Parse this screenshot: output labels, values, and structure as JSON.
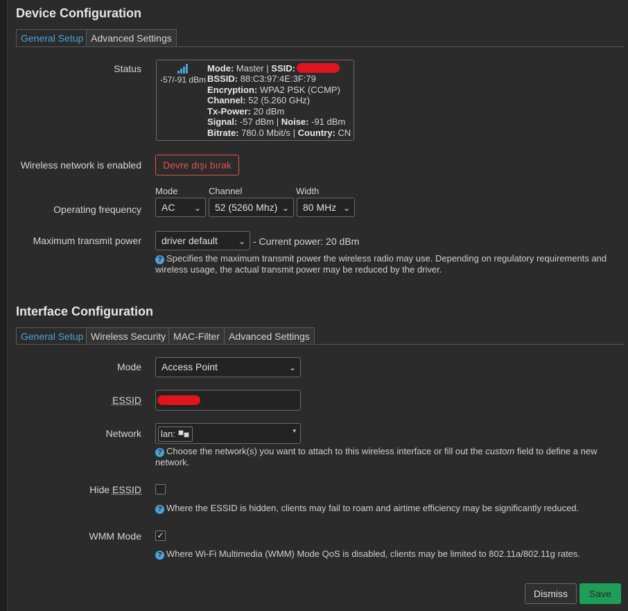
{
  "device": {
    "title": "Device Configuration",
    "tabs": [
      "General Setup",
      "Advanced Settings"
    ],
    "status": {
      "label": "Status",
      "signal_icon": "signal-bars-icon",
      "signal_text": "-57/-91 dBm",
      "mode_label": "Mode:",
      "mode_value": "Master",
      "sep": "|",
      "ssid_label": "SSID:",
      "bssid_label": "BSSID:",
      "bssid_value": "88:C3:97:4E:3F:79",
      "enc_label": "Encryption:",
      "enc_value": "WPA2 PSK (CCMP)",
      "channel_label": "Channel:",
      "channel_value": "52 (5.260 GHz)",
      "txpower_label": "Tx-Power:",
      "txpower_value": "20 dBm",
      "signal_label": "Signal:",
      "signal_value": "-57 dBm",
      "noise_label": "Noise:",
      "noise_value": "-91 dBm",
      "bitrate_label": "Bitrate:",
      "bitrate_value": "780.0 Mbit/s",
      "country_label": "Country:",
      "country_value": "CN"
    },
    "enabled": {
      "label": "Wireless network is enabled",
      "button": "Devre dışı bırak"
    },
    "frequency": {
      "label": "Operating frequency",
      "mode_header": "Mode",
      "channel_header": "Channel",
      "width_header": "Width",
      "mode_value": "AC",
      "channel_value": "52 (5260 Mhz)",
      "width_value": "80 MHz"
    },
    "txpower": {
      "label": "Maximum transmit power",
      "value": "driver default",
      "current": "- Current power: 20 dBm",
      "help": "Specifies the maximum transmit power the wireless radio may use. Depending on regulatory requirements and wireless usage, the actual transmit power may be reduced by the driver."
    }
  },
  "interface": {
    "title": "Interface Configuration",
    "tabs": [
      "General Setup",
      "Wireless Security",
      "MAC-Filter",
      "Advanced Settings"
    ],
    "mode": {
      "label": "Mode",
      "value": "Access Point"
    },
    "essid": {
      "label": "ESSID"
    },
    "network": {
      "label": "Network",
      "value": "lan:",
      "help_before": "Choose the network(s) you want to attach to this wireless interface or fill out the",
      "help_custom": "custom",
      "help_after": "field to define a new network."
    },
    "hide_essid": {
      "label_prefix": "Hide",
      "label_essid": "ESSID",
      "checked": false,
      "help": "Where the ESSID is hidden, clients may fail to roam and airtime efficiency may be significantly reduced."
    },
    "wmm": {
      "label": "WMM Mode",
      "checked": true,
      "help": "Where Wi-Fi Multimedia (WMM) Mode QoS is disabled, clients may be limited to 802.11a/802.11g rates."
    }
  },
  "footer": {
    "dismiss": "Dismiss",
    "save": "Save"
  },
  "colors": {
    "accent": "#4aa3d9",
    "danger": "#e05252",
    "save": "#1e9e57"
  }
}
